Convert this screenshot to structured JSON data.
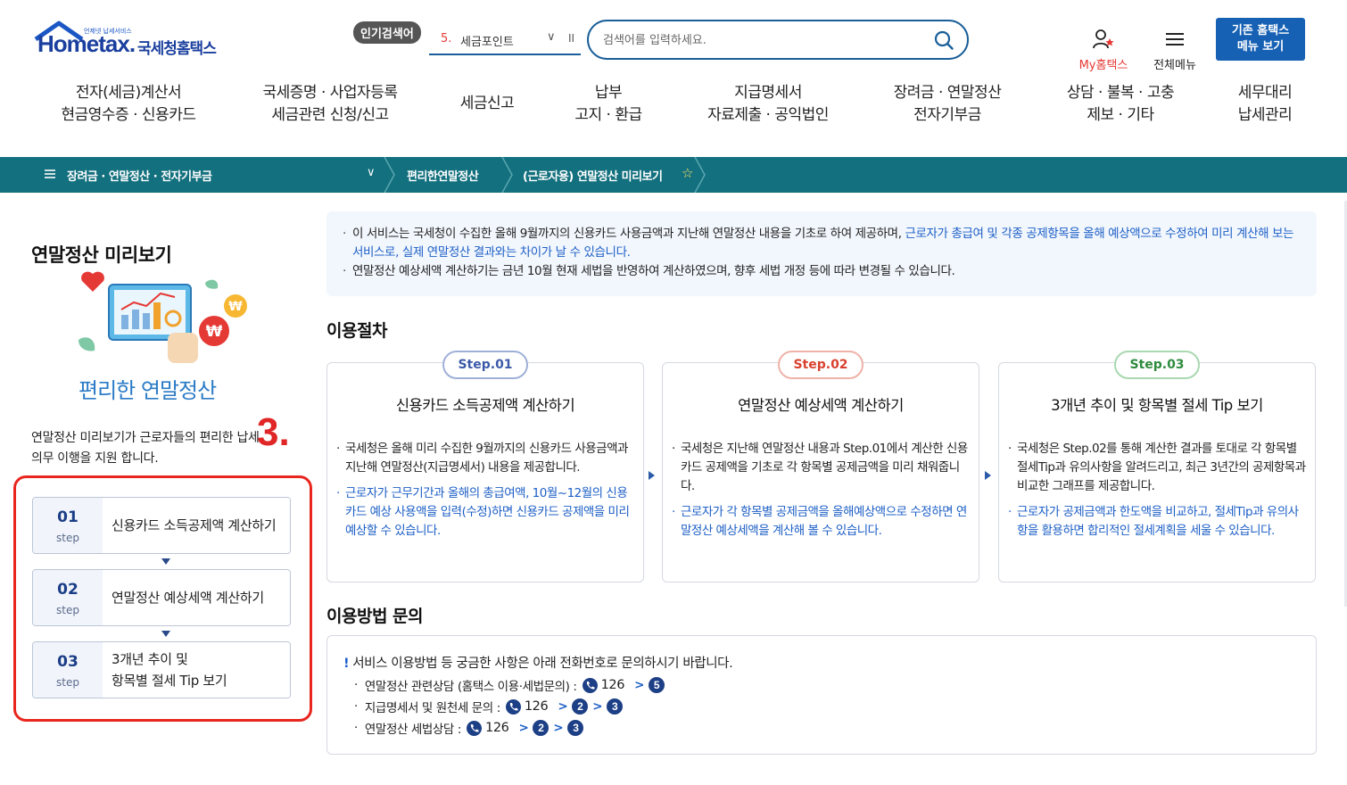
{
  "header": {
    "logo_tagline": "언제넷 납세서비스",
    "logo_main": "Hometax.",
    "logo_kr": "국세청홈택스",
    "popular_badge": "인기검색어",
    "popular_rank": "5.",
    "popular_term": "세금포인트",
    "popular_chevron": "∨",
    "popular_pause": "II",
    "search_placeholder": "검색어를 입력하세요.",
    "my_hometax_label": "My홈택스",
    "all_menu_label": "전체메뉴",
    "legacy_line1": "기존 홈택스",
    "legacy_line2": "메뉴 보기",
    "nav": [
      {
        "l1": "전자(세금)계산서",
        "l2": "현금영수증 · 신용카드"
      },
      {
        "l1": "국세증명 · 사업자등록",
        "l2": "세금관련 신청/신고"
      },
      {
        "l1": "세금신고",
        "l2": ""
      },
      {
        "l1": "납부",
        "l2": "고지 · 환급"
      },
      {
        "l1": "지급명세서",
        "l2": "자료제출 · 공익법인"
      },
      {
        "l1": "장려금 · 연말정산",
        "l2": "전자기부금"
      },
      {
        "l1": "상담 · 불복 · 고충",
        "l2": "제보 · 기타"
      },
      {
        "l1": "세무대리",
        "l2": "납세관리"
      }
    ]
  },
  "breadcrumb": {
    "menu_icon": "hamburger-icon",
    "level1": "장려금 · 연말정산 · 전자기부금",
    "level1_chevron": "∨",
    "level2": "편리한연말정산",
    "level3": "(근로자용) 연말정산 미리보기",
    "favorite_star": "☆"
  },
  "left": {
    "title": "연말정산 미리보기",
    "illustration_caption": "편리한 연말정산",
    "desc_line1": "연말정산 미리보기가 근로자들의  편리한 납세",
    "desc_line2": "의무 이행을 지원 합니다.",
    "overlay_number": "3.",
    "steps": [
      {
        "num": "01",
        "label": "step",
        "text": "신용카드 소득공제액 계산하기"
      },
      {
        "num": "02",
        "label": "step",
        "text": "연말정산 예상세액 계산하기"
      },
      {
        "num": "03",
        "label": "step",
        "text": "3개년 추이 및\n항목별 절세 Tip 보기"
      }
    ]
  },
  "notice": {
    "line1_plain": "이 서비스는 국세청이 수집한 올해 9월까지의 신용카드 사용금액과 지난해 연말정산 내용을 기초로 하여 제공하며, ",
    "line1_blue": "근로자가 총급여 및 각종 공제항목을 올해 예상액으로 수정하여 미리 계산해 보는 서비스로, 실제 연말정산 결과와는 차이가 날 수 있습니다.",
    "line2": "연말정산 예상세액 계산하기는 금년 10월 현재 세법을 반영하여 계산하였으며, 향후 세법 개정 등에 따라 변경될 수 있습니다."
  },
  "procedure": {
    "title": "이용절차",
    "steps": [
      {
        "badge": "Step.01",
        "title": "신용카드 소득공제액 계산하기",
        "body": "국세청은 올해 미리 수집한 9월까지의 신용카드 사용금액과 지난해 연말정산(지급명세서) 내용을 제공합니다.",
        "body_blue": "근로자가 근무기간과 올해의 총급여액, 10월~12월의 신용카드 예상 사용액을 입력(수정)하면 신용카드 공제액을 미리 예상할 수 있습니다."
      },
      {
        "badge": "Step.02",
        "title": "연말정산 예상세액 계산하기",
        "body": "국세청은 지난해 연말정산 내용과 Step.01에서 계산한 신용카드 공제액을 기초로 각 항목별 공제금액을 미리 채워줍니다.",
        "body_blue": "근로자가 각 항목별 공제금액을 올해예상액으로 수정하면 연말정산 예상세액을 계산해 볼 수 있습니다."
      },
      {
        "badge": "Step.03",
        "title": "3개년 추이 및 항목별 절세 Tip 보기",
        "body": "국세청은 Step.02를 통해 계산한 결과를 토대로 각 항목별 절세Tip과 유의사항을 알려드리고, 최근 3년간의 공제항목과 비교한 그래프를 제공합니다.",
        "body_blue": "근로자가 공제금액과 한도액을 비교하고, 절세Tip과 유의사항을 활용하면 합리적인 절세계획을 세울 수 있습니다."
      }
    ],
    "badge_colors": [
      "#3b5aa8",
      "#d9412e",
      "#2e8b3e"
    ]
  },
  "inquiry": {
    "title": "이용방법 문의",
    "head_bang": "!",
    "head": "서비스 이용방법 등 궁금한 사항은 아래 전화번호로 문의하시기 바랍니다.",
    "lines": [
      {
        "label": "연말정산 관련상담 (홈택스 이용·세법문의) :",
        "phone": "126",
        "keys": [
          "5"
        ]
      },
      {
        "label": "지급명세서 및 원천세 문의 :",
        "phone": "126",
        "keys": [
          "2",
          "3"
        ]
      },
      {
        "label": "연말정산 세법상담 :",
        "phone": "126",
        "keys": [
          "2",
          "3"
        ]
      }
    ]
  }
}
